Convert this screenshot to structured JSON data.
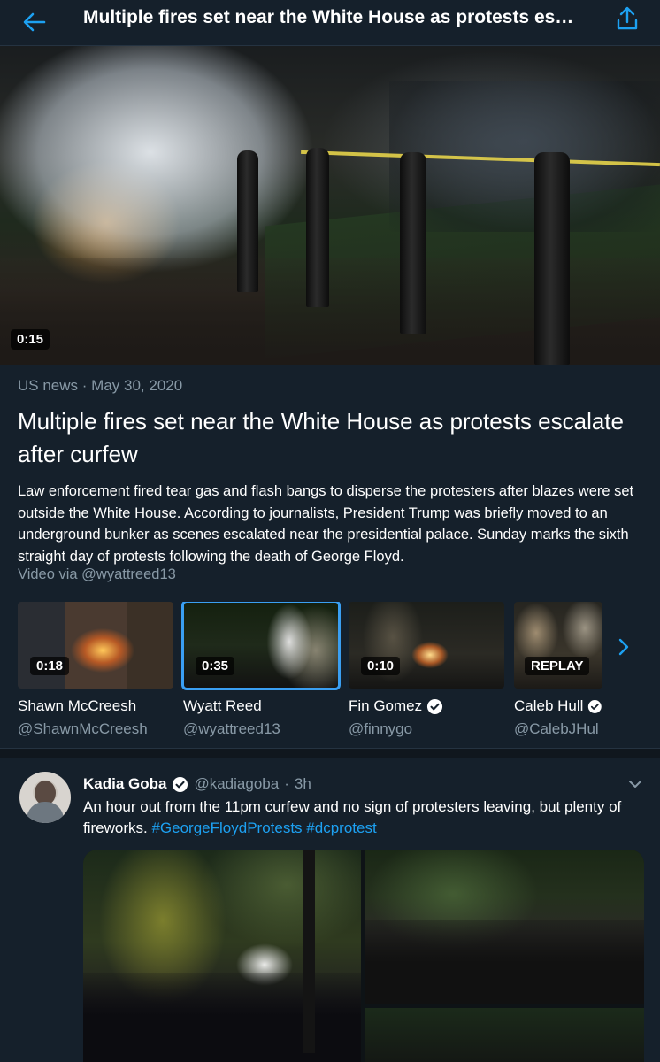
{
  "header": {
    "title": "Multiple fires set near the White House as protests es…",
    "back_icon": "arrow-left-icon",
    "share_icon": "share-icon"
  },
  "hero": {
    "duration": "0:15"
  },
  "moment": {
    "category": "US news",
    "separator": "·",
    "date": "May 30, 2020",
    "title": "Multiple fires set near the White House as protests escalate after curfew",
    "description": "Law enforcement fired tear gas and flash bangs to disperse the protesters after blazes were set outside the White House. According to journalists, President Trump was briefly moved to an underground bunker as scenes escalated near the presidential palace. Sunday marks the sixth straight day of protests following the death of George Floyd.",
    "video_via": "Video via @wyattreed13"
  },
  "videos": [
    {
      "badge": "0:18",
      "name": "Shawn McCreesh",
      "handle": "@ShawnMcCreesh",
      "verified": false,
      "selected": false
    },
    {
      "badge": "0:35",
      "name": "Wyatt Reed",
      "handle": "@wyattreed13",
      "verified": false,
      "selected": true
    },
    {
      "badge": "0:10",
      "name": "Fin Gomez",
      "handle": "@finnygo",
      "verified": true,
      "selected": false
    },
    {
      "badge": "REPLAY",
      "name": "Caleb Hull",
      "handle": "@CalebJHul",
      "verified": true,
      "selected": false
    }
  ],
  "tweet": {
    "author": "Kadia Goba",
    "handle": "@kadiagoba",
    "separator": "·",
    "time": "3h",
    "text_plain": "An hour out from the 11pm curfew and no sign of protesters leaving, but plenty of fireworks. ",
    "hashtag_1": "#GeorgeFloydProtests",
    "hashtag_2": "#dcprotest"
  },
  "colors": {
    "background": "#15202b",
    "accent": "#1da1f2",
    "muted": "#8899a6",
    "selected_outline": "#3a9ff2"
  }
}
